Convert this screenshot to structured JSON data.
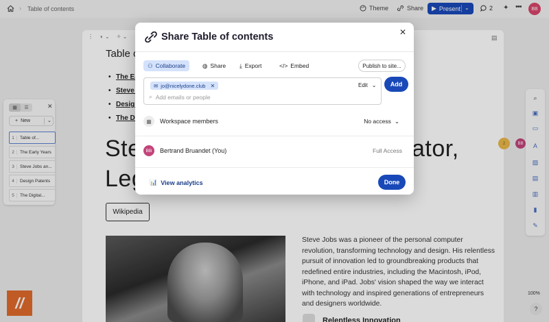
{
  "topbar": {
    "breadcrumb": "Table of contents",
    "theme_label": "Theme",
    "share_label": "Share",
    "present_label": "Present",
    "comments_count": "2",
    "avatar_initials": "BB"
  },
  "document": {
    "title": "Table of contents",
    "toc_items": [
      "The Early Years",
      "Steve Jobs and...",
      "Design Patents",
      "The Digital..."
    ],
    "heading_line1": "Ste",
    "heading_line1_right": "ator,",
    "heading_line2": "Leg",
    "wiki_button": "Wikipedia",
    "body_text": "Steve Jobs was a pioneer of the personal computer revolution, transforming technology and design. His relentless pursuit of innovation led to groundbreaking products that redefined entire industries, including the Macintosh, iPod, iPhone, and iPad. Jobs' vision shaped the way we interact with technology and inspired generations of entrepreneurs and designers worldwide.",
    "subheading": "Relentless Innovation"
  },
  "left_panel": {
    "new_label": "New",
    "items": [
      {
        "num": "1",
        "label": "Table of..."
      },
      {
        "num": "2",
        "label": "The Early Years"
      },
      {
        "num": "3",
        "label": "Steve Jobs an..."
      },
      {
        "num": "4",
        "label": "Design Patents"
      },
      {
        "num": "5",
        "label": "The Digital..."
      }
    ]
  },
  "right_rail": {
    "zoom": "100%",
    "help": "?"
  },
  "collaborators": {
    "first_count": "2",
    "second_initials": "BB"
  },
  "modal": {
    "title": "Share Table of contents",
    "tabs": [
      "Collaborate",
      "Share",
      "Export",
      "Embed"
    ],
    "publish_label": "Publish to site...",
    "email_chip": "jo@nicelydone.club",
    "permission": "Edit",
    "input_placeholder": "Add emails or people",
    "add_button": "Add",
    "workspace_label": "Workspace members",
    "workspace_access": "No access",
    "user_initials": "BB",
    "user_name": "Bertrand Bruandet (You)",
    "user_access": "Full Access",
    "analytics_label": "View analytics",
    "done_button": "Done"
  },
  "colors": {
    "primary": "#1949b8",
    "accent_soft": "#d4e2fb",
    "avatar": "#c2447a",
    "logo": "#e06a2c"
  }
}
